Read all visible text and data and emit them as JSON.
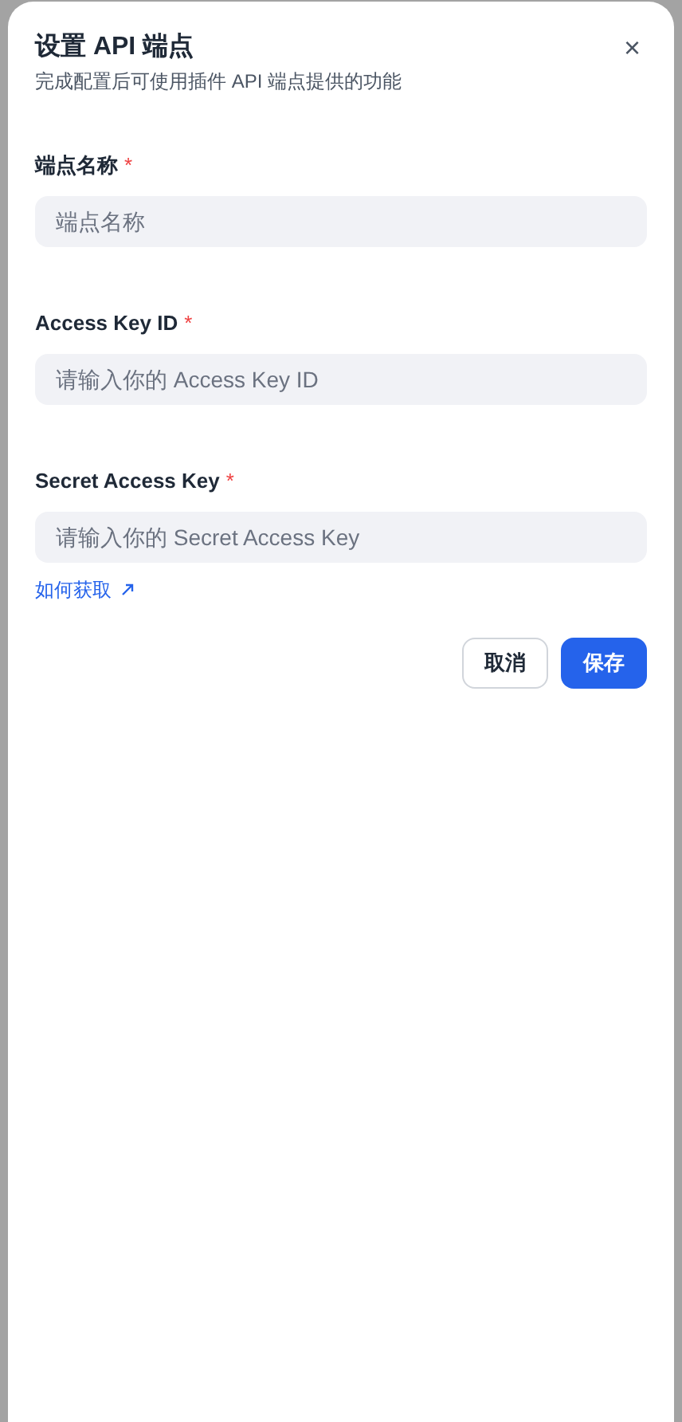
{
  "dialog": {
    "title": "设置 API 端点",
    "subtitle": "完成配置后可使用插件 API 端点提供的功能",
    "close_icon": "×",
    "fields": [
      {
        "label": "端点名称",
        "required_mark": "*",
        "placeholder": "端点名称"
      },
      {
        "label": "Access Key ID",
        "required_mark": "*",
        "placeholder": "请输入你的 Access Key ID"
      },
      {
        "label": "Secret Access Key",
        "required_mark": "*",
        "placeholder": "请输入你的 Secret Access Key"
      }
    ],
    "help_link": "如何获取",
    "buttons": [
      {
        "label": "取消",
        "kind": "secondary"
      },
      {
        "label": "保存",
        "kind": "primary"
      }
    ]
  }
}
